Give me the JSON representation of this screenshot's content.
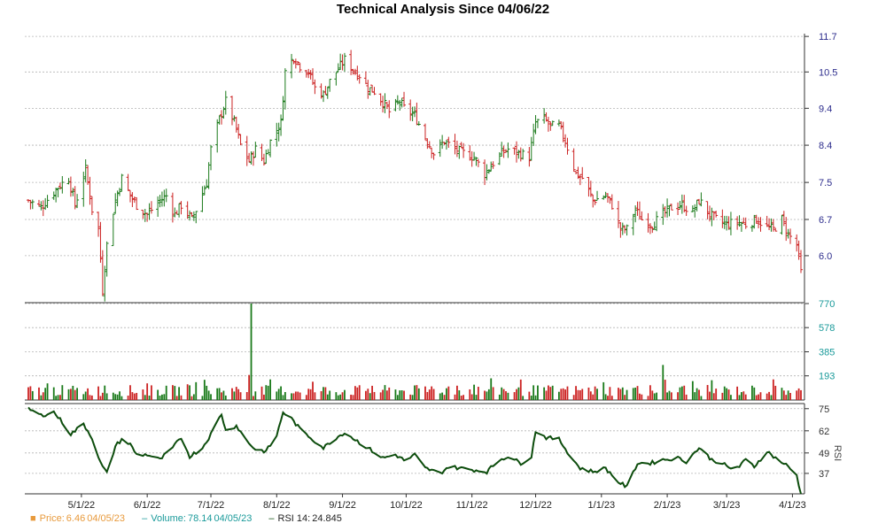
{
  "title": "Technical Analysis Since 04/06/22",
  "colors": {
    "up": "#1a7a1a",
    "down": "#cc2222",
    "grid": "#b4b4b4",
    "price_axis": "#2c2c8c",
    "volume_axis": "#1a9a9a",
    "rsi_axis": "#333333",
    "rsi_line": "#0d4d0d",
    "price_legend": "#e89a3c",
    "volume_legend": "#1a9a9a"
  },
  "legend": {
    "price": {
      "icon": "square-icon",
      "label": "Price:",
      "value": "6.46",
      "date": "04/05/23"
    },
    "volume": {
      "icon": "dash-icon",
      "label": "Volume:",
      "value": "78.14",
      "date": "04/05/23"
    },
    "rsi": {
      "icon": "dash-icon",
      "label": "RSI 14:",
      "value": "24.845"
    }
  },
  "chart_data": [
    {
      "type": "ohlc",
      "panel": "price",
      "title": "Technical Analysis Since 04/06/22",
      "yticks": [
        "11.7",
        "10.5",
        "9.4",
        "8.4",
        "7.5",
        "6.7",
        "6.0"
      ],
      "ylim": [
        5.2,
        11.8
      ],
      "grid": true,
      "xticks": [
        "5/1/22",
        "6/1/22",
        "7/1/22",
        "8/1/22",
        "9/1/22",
        "10/1/22",
        "11/1/22",
        "12/1/22",
        "1/1/23",
        "2/1/23",
        "3/1/23",
        "4/1/23"
      ],
      "x_start": "2022-04-06",
      "x_end": "2023-04-05",
      "close_anchors": [
        [
          "2022-04-06",
          7.1
        ],
        [
          "2022-04-12",
          6.95
        ],
        [
          "2022-04-20",
          7.4
        ],
        [
          "2022-04-25",
          7.6
        ],
        [
          "2022-04-28",
          7.0
        ],
        [
          "2022-05-03",
          7.8
        ],
        [
          "2022-05-06",
          6.9
        ],
        [
          "2022-05-09",
          6.5
        ],
        [
          "2022-05-11",
          5.4
        ],
        [
          "2022-05-13",
          6.2
        ],
        [
          "2022-05-17",
          7.1
        ],
        [
          "2022-05-20",
          7.6
        ],
        [
          "2022-05-24",
          7.2
        ],
        [
          "2022-05-27",
          7.0
        ],
        [
          "2022-06-01",
          6.8
        ],
        [
          "2022-06-07",
          7.1
        ],
        [
          "2022-06-10",
          7.2
        ],
        [
          "2022-06-14",
          6.8
        ],
        [
          "2022-06-17",
          7.0
        ],
        [
          "2022-06-22",
          6.7
        ],
        [
          "2022-06-24",
          6.9
        ],
        [
          "2022-06-29",
          7.5
        ],
        [
          "2022-07-01",
          8.3
        ],
        [
          "2022-07-05",
          9.1
        ],
        [
          "2022-07-08",
          9.6
        ],
        [
          "2022-07-12",
          9.0
        ],
        [
          "2022-07-15",
          8.4
        ],
        [
          "2022-07-19",
          8.0
        ],
        [
          "2022-07-22",
          8.3
        ],
        [
          "2022-07-26",
          8.0
        ],
        [
          "2022-07-29",
          8.5
        ],
        [
          "2022-08-03",
          9.0
        ],
        [
          "2022-08-05",
          10.5
        ],
        [
          "2022-08-09",
          11.0
        ],
        [
          "2022-08-12",
          10.7
        ],
        [
          "2022-08-16",
          10.5
        ],
        [
          "2022-08-19",
          10.0
        ],
        [
          "2022-08-23",
          9.8
        ],
        [
          "2022-08-26",
          10.2
        ],
        [
          "2022-08-31",
          10.7
        ],
        [
          "2022-09-02",
          10.9
        ],
        [
          "2022-09-07",
          10.5
        ],
        [
          "2022-09-09",
          10.4
        ],
        [
          "2022-09-13",
          10.0
        ],
        [
          "2022-09-16",
          9.9
        ],
        [
          "2022-09-21",
          9.5
        ],
        [
          "2022-09-23",
          9.3
        ],
        [
          "2022-09-28",
          9.6
        ],
        [
          "2022-09-30",
          9.4
        ],
        [
          "2022-10-05",
          9.2
        ],
        [
          "2022-10-10",
          8.6
        ],
        [
          "2022-10-14",
          8.2
        ],
        [
          "2022-10-19",
          8.5
        ],
        [
          "2022-10-24",
          8.3
        ],
        [
          "2022-10-28",
          8.2
        ],
        [
          "2022-11-02",
          8.1
        ],
        [
          "2022-11-07",
          7.7
        ],
        [
          "2022-11-10",
          7.9
        ],
        [
          "2022-11-15",
          8.2
        ],
        [
          "2022-11-18",
          8.3
        ],
        [
          "2022-11-23",
          8.2
        ],
        [
          "2022-11-28",
          8.1
        ],
        [
          "2022-12-01",
          9.0
        ],
        [
          "2022-12-05",
          9.1
        ],
        [
          "2022-12-08",
          8.9
        ],
        [
          "2022-12-12",
          8.9
        ],
        [
          "2022-12-15",
          8.5
        ],
        [
          "2022-12-20",
          7.7
        ],
        [
          "2022-12-23",
          7.6
        ],
        [
          "2022-12-28",
          7.1
        ],
        [
          "2023-01-03",
          7.2
        ],
        [
          "2023-01-06",
          7.0
        ],
        [
          "2023-01-10",
          6.5
        ],
        [
          "2023-01-13",
          6.5
        ],
        [
          "2023-01-17",
          6.9
        ],
        [
          "2023-01-20",
          6.7
        ],
        [
          "2023-01-25",
          6.6
        ],
        [
          "2023-01-30",
          6.8
        ],
        [
          "2023-02-03",
          6.95
        ],
        [
          "2023-02-08",
          7.0
        ],
        [
          "2023-02-13",
          6.85
        ],
        [
          "2023-02-16",
          7.1
        ],
        [
          "2023-02-21",
          6.8
        ],
        [
          "2023-02-24",
          6.7
        ],
        [
          "2023-03-01",
          6.6
        ],
        [
          "2023-03-06",
          6.65
        ],
        [
          "2023-03-10",
          6.6
        ],
        [
          "2023-03-15",
          6.7
        ],
        [
          "2023-03-20",
          6.55
        ],
        [
          "2023-03-23",
          6.5
        ],
        [
          "2023-03-27",
          6.7
        ],
        [
          "2023-03-30",
          6.4
        ],
        [
          "2023-04-03",
          6.2
        ],
        [
          "2023-04-05",
          5.7
        ]
      ]
    },
    {
      "type": "bar",
      "panel": "volume",
      "yticks": [
        "770",
        "578",
        "385",
        "193"
      ],
      "ylim": [
        0,
        770
      ],
      "grid": true,
      "typical_range": [
        30,
        120
      ],
      "spikes": [
        [
          "2022-07-20",
          770
        ],
        [
          "2023-01-30",
          280
        ],
        [
          "2022-07-19",
          200
        ]
      ],
      "last": [
        "2023-04-05",
        78.14
      ]
    },
    {
      "type": "line",
      "panel": "rsi",
      "ylabel": "RSI",
      "yticks": [
        "75",
        "62",
        "49",
        "37"
      ],
      "ylim": [
        25,
        78
      ],
      "grid": true,
      "values": [
        [
          "2022-04-06",
          75
        ],
        [
          "2022-04-12",
          71
        ],
        [
          "2022-04-18",
          73
        ],
        [
          "2022-04-22",
          67
        ],
        [
          "2022-04-26",
          60
        ],
        [
          "2022-05-02",
          66
        ],
        [
          "2022-05-06",
          58
        ],
        [
          "2022-05-10",
          43
        ],
        [
          "2022-05-13",
          37
        ],
        [
          "2022-05-17",
          53
        ],
        [
          "2022-05-20",
          57
        ],
        [
          "2022-05-24",
          54
        ],
        [
          "2022-05-27",
          48
        ],
        [
          "2022-06-01",
          48
        ],
        [
          "2022-06-07",
          45
        ],
        [
          "2022-06-13",
          52
        ],
        [
          "2022-06-17",
          58
        ],
        [
          "2022-06-21",
          47
        ],
        [
          "2022-06-27",
          52
        ],
        [
          "2022-07-01",
          60
        ],
        [
          "2022-07-06",
          72
        ],
        [
          "2022-07-08",
          62
        ],
        [
          "2022-07-13",
          65
        ],
        [
          "2022-07-18",
          56
        ],
        [
          "2022-07-22",
          51
        ],
        [
          "2022-07-27",
          50
        ],
        [
          "2022-08-01",
          59
        ],
        [
          "2022-08-04",
          73
        ],
        [
          "2022-08-08",
          69
        ],
        [
          "2022-08-12",
          63
        ],
        [
          "2022-08-18",
          57
        ],
        [
          "2022-08-23",
          52
        ],
        [
          "2022-08-29",
          58
        ],
        [
          "2022-09-02",
          61
        ],
        [
          "2022-09-08",
          56
        ],
        [
          "2022-09-14",
          51
        ],
        [
          "2022-09-20",
          46
        ],
        [
          "2022-09-26",
          48
        ],
        [
          "2022-10-01",
          44
        ],
        [
          "2022-10-05",
          48
        ],
        [
          "2022-10-10",
          40
        ],
        [
          "2022-10-17",
          37
        ],
        [
          "2022-10-21",
          41
        ],
        [
          "2022-10-27",
          40
        ],
        [
          "2022-11-02",
          39
        ],
        [
          "2022-11-08",
          38
        ],
        [
          "2022-11-14",
          45
        ],
        [
          "2022-11-18",
          47
        ],
        [
          "2022-11-24",
          43
        ],
        [
          "2022-11-29",
          47
        ],
        [
          "2022-12-01",
          62
        ],
        [
          "2022-12-06",
          58
        ],
        [
          "2022-12-12",
          57
        ],
        [
          "2022-12-18",
          46
        ],
        [
          "2022-12-22",
          40
        ],
        [
          "2022-12-28",
          38
        ],
        [
          "2023-01-03",
          40
        ],
        [
          "2023-01-09",
          32
        ],
        [
          "2023-01-13",
          29
        ],
        [
          "2023-01-18",
          43
        ],
        [
          "2023-01-24",
          43
        ],
        [
          "2023-01-30",
          45
        ],
        [
          "2023-02-06",
          46
        ],
        [
          "2023-02-10",
          44
        ],
        [
          "2023-02-16",
          52
        ],
        [
          "2023-02-22",
          45
        ],
        [
          "2023-02-27",
          43
        ],
        [
          "2023-03-02",
          40
        ],
        [
          "2023-03-07",
          41
        ],
        [
          "2023-03-10",
          45
        ],
        [
          "2023-03-14",
          41
        ],
        [
          "2023-03-20",
          50
        ],
        [
          "2023-03-25",
          45
        ],
        [
          "2023-03-29",
          42
        ],
        [
          "2023-04-03",
          36
        ],
        [
          "2023-04-05",
          24.845
        ]
      ]
    }
  ]
}
